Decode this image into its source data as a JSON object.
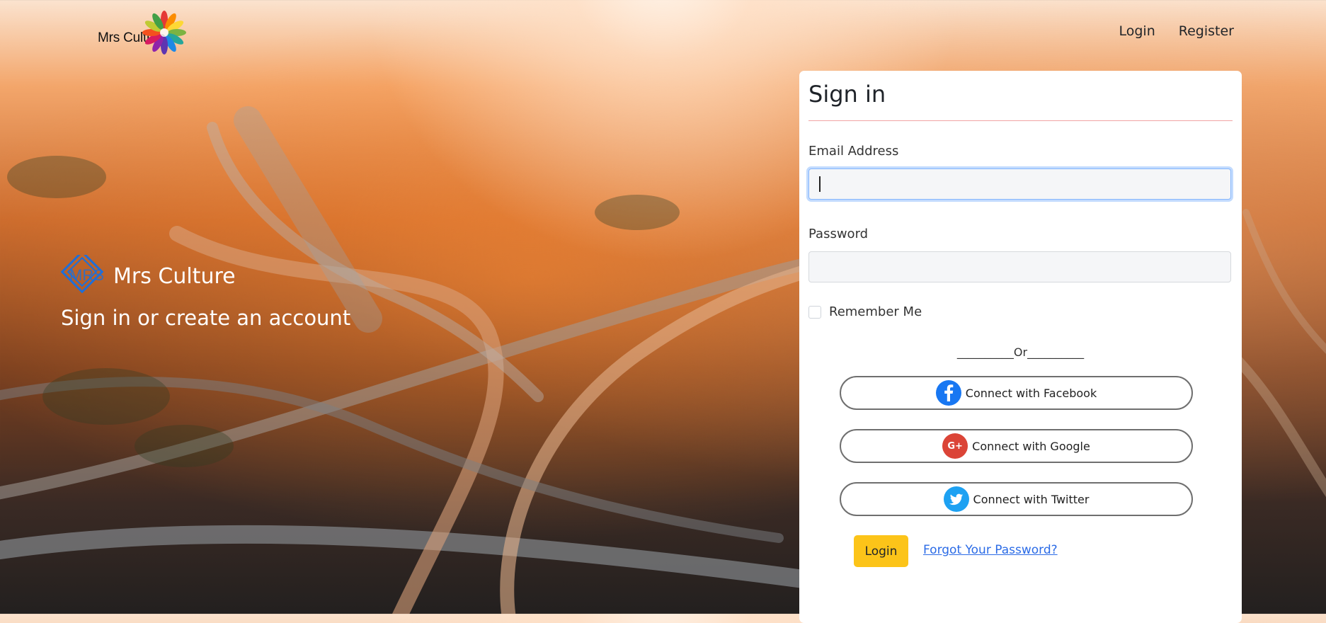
{
  "header": {
    "brand": "Mrs Culture",
    "nav": [
      {
        "label": "Login"
      },
      {
        "label": "Register"
      }
    ]
  },
  "hero": {
    "logo_text": "MRS",
    "brand": "Mrs Culture",
    "subtitle": "Sign in or create an account"
  },
  "form": {
    "title": "Sign in",
    "email_label": "Email Address",
    "email_value": "",
    "password_label": "Password",
    "password_value": "",
    "remember_label": "Remember Me",
    "separator": "__________Or__________",
    "facebook_label": "Connect with Facebook",
    "google_label": "Connect with Google",
    "twitter_label": "Connect with Twitter",
    "login_label": "Login",
    "forgot_label": "Forgot Your Password?"
  },
  "colors": {
    "accent": "#fcc419",
    "link": "#2b6be6",
    "facebook": "#1877f2",
    "google": "#db4437",
    "twitter": "#1da1f2",
    "hero_logo": "#1e6fd9"
  }
}
